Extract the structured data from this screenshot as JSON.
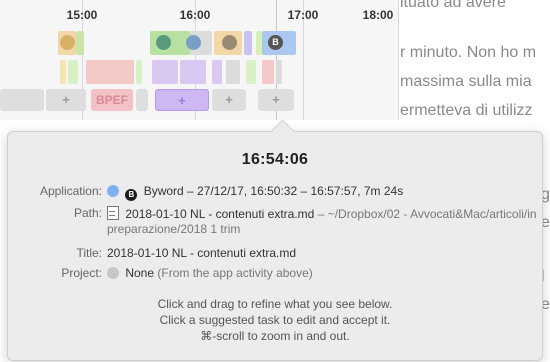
{
  "document_lines": [
    "ituato ad avere",
    "r minuto. Non ho m",
    "massima sulla mia",
    "ermetteva di utilizz",
    "g",
    "e",
    "l",
    "e"
  ],
  "timeline": {
    "ticks": [
      "15:00",
      "16:00",
      "17:00",
      "18:00"
    ],
    "suggested_tasks": [
      "+",
      "+",
      "BPEF",
      "+",
      "+",
      "+"
    ],
    "app_icon_letters": [
      "B"
    ]
  },
  "popover": {
    "time": "16:54:06",
    "application": {
      "label": "Application:",
      "name": "Byword",
      "details": "– 27/12/17, 16:50:32 – 16:57:57, 7m 24s",
      "icon_letter": "B"
    },
    "path": {
      "label": "Path:",
      "file": "2018-01-10 NL - contenuti extra.md",
      "location": "– ~/Dropbox/02 - Avvocati&Mac/articoli/in preparazione/2018 1 trim"
    },
    "title": {
      "label": "Title:",
      "value": "2018-01-10 NL - contenuti extra.md"
    },
    "project": {
      "label": "Project:",
      "value": "None",
      "note": "(From the app activity above)"
    },
    "hints": [
      "Click and drag to refine what you see below.",
      "Click a suggested task to edit and accept it.",
      "⌘-scroll to zoom in and out."
    ]
  },
  "colors": {
    "accent_blue": "#7fb1f0",
    "suggested_purple": "#cdb8f3",
    "suggested_pink": "#f2c2c6"
  }
}
